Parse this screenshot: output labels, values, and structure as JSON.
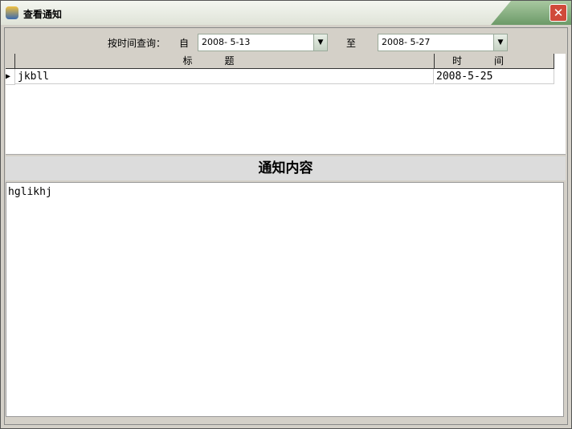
{
  "window": {
    "title": "查看通知"
  },
  "query": {
    "label": "按时间查询：",
    "from_label": "自",
    "from_value": "2008- 5-13",
    "to_label": "至",
    "to_value": "2008- 5-27"
  },
  "grid": {
    "columns": [
      "标题",
      "时间"
    ],
    "rows": [
      {
        "title": "jkbll",
        "time": "2008-5-25"
      }
    ]
  },
  "content": {
    "heading": "通知内容",
    "text": "hglikhj"
  }
}
